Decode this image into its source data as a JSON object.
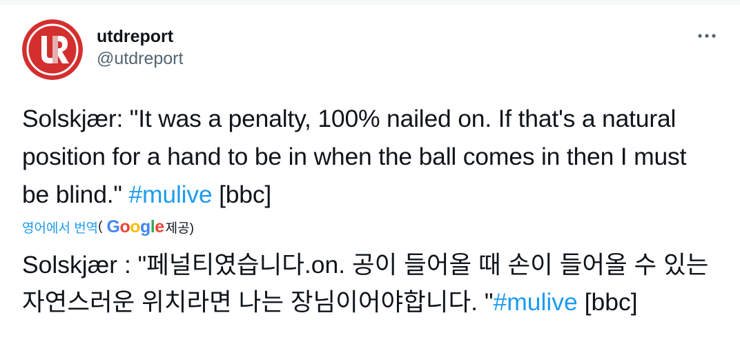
{
  "tweet": {
    "display_name": "utdreport",
    "handle": "@utdreport",
    "more_icon": "more-horizontal-icon",
    "text_before_hashtag": "Solskjær: \"It was a penalty, 100% nailed on. If that's a natural position for a hand to be in when the ball comes in then I must be blind.\" ",
    "hashtag": "#mulive",
    "text_after_hashtag": " [bbc]"
  },
  "translation": {
    "link_label": "영어에서 번역",
    "open_paren": "(",
    "provider": "Google",
    "provided_label": " 제공)",
    "text_before_hashtag": "Solskjær : \"페널티였습니다.on. 공이 들어올 때 손이 들어올 수 있는 자연스러운 위치라면 나는 장님이어야합니다. \"",
    "hashtag": "#mulive",
    "text_after_hashtag": " [bbc]"
  },
  "colors": {
    "avatar_red": "#d32f2f",
    "hashtag_blue": "#1d9bf0",
    "secondary_text": "#536471",
    "google_blue": "#4285F4",
    "google_red": "#EA4335",
    "google_yellow": "#FBBC05",
    "google_green": "#34A853"
  }
}
